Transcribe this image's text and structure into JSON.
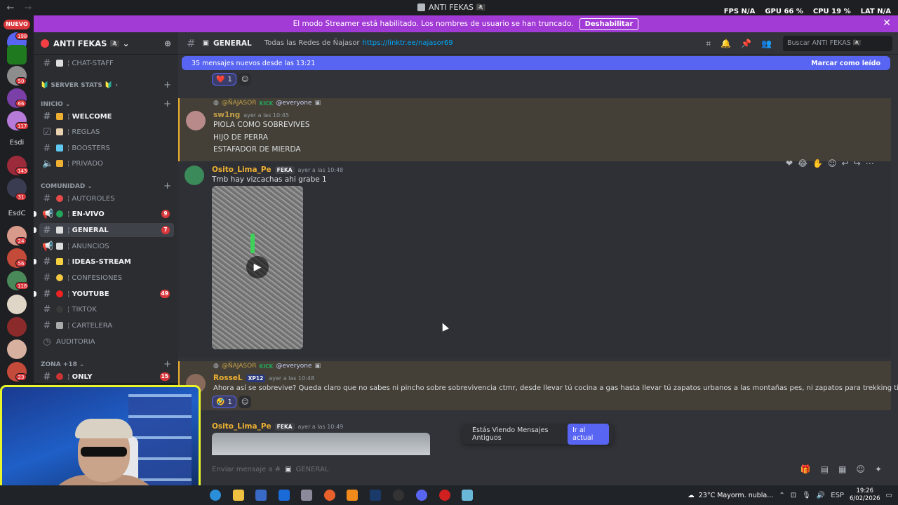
{
  "window": {
    "title": "ANTI FEKAS 🏴‍☠️"
  },
  "overlay": {
    "fps_label": "FPS",
    "fps": "N/A",
    "gpu_label": "GPU",
    "gpu": "66 %",
    "cpu_label": "CPU",
    "cpu": "19 %",
    "lat_label": "LAT",
    "lat": "N/A"
  },
  "banner": {
    "text": "El modo Streamer está habilitado. Los nombres de usuario se han truncado.",
    "button": "Deshabilitar",
    "close": "✕"
  },
  "rail": {
    "nuevo": "NUEVO",
    "badges": [
      "198",
      "50",
      "66",
      "117",
      "143",
      "31",
      "24",
      "56",
      "118",
      "23"
    ],
    "texts": [
      "Esdi",
      "EsdC"
    ]
  },
  "server": {
    "name": "ANTI FEKAS 🏴‍☠️"
  },
  "sidebar": {
    "channels": [
      {
        "label": "CHAT-STAFF"
      },
      {
        "label": "🔰 SERVER STATS 🔰"
      },
      {
        "label": "INICIO"
      },
      {
        "label": "WELCOME"
      },
      {
        "label": "REGLAS"
      },
      {
        "label": "BOOSTERS"
      },
      {
        "label": "PRIVADO"
      },
      {
        "label": "COMUNIDAD"
      },
      {
        "label": "AUTOROLES"
      },
      {
        "label": "EN-VIVO",
        "count": "9"
      },
      {
        "label": "GENERAL",
        "count": "7"
      },
      {
        "label": "ANUNCIOS"
      },
      {
        "label": "IDEAS-STREAM"
      },
      {
        "label": "CONFESIONES"
      },
      {
        "label": "YOUTUBE",
        "count": "49"
      },
      {
        "label": "TIKTOK"
      },
      {
        "label": "CARTELERA"
      },
      {
        "label": "AUDITORIA"
      },
      {
        "label": "ZONA +18"
      },
      {
        "label": "ONLY",
        "count": "15"
      }
    ]
  },
  "header": {
    "channel": "GENERAL",
    "topic": "Todas las Redes de Ñajasor",
    "link": "https://linktr.ee/najasor69",
    "search_placeholder": "Buscar ANTI FEKAS 🏴‍☠️"
  },
  "newbar": {
    "text": "35 mensajes nuevos desde las 13:21",
    "mark": "Marcar como leído"
  },
  "messages": [
    {
      "reply_user": "@ÑAJASOR",
      "reply_tag": "KICK",
      "reply_mention": "@everyone",
      "user": "sw1ng",
      "time": "ayer a las 10:45",
      "user_color": "#c5a04a",
      "lines": [
        "PIOLA COMO SOBREVIVES",
        "HIJO DE PERRA",
        "ESTAFADOR DE MIERDA"
      ]
    },
    {
      "user": "Osito_Lima_Pe",
      "tag": "FEKA",
      "time": "ayer a las 10:48",
      "user_color": "#f0b132",
      "lines": [
        "Tmb hay vizcachas ahi grabe 1"
      ]
    },
    {
      "reply_user": "@ÑAJASOR",
      "reply_tag": "KICK",
      "reply_mention": "@everyone",
      "user": "RosseL",
      "tag": "XP12",
      "time": "ayer a las 10:48",
      "user_color": "#f0b132",
      "lines": [
        "Ahora así se sobrevive? Queda claro que no sabes ni pincho sobre sobrevivencia ctmr, desde llevar tú cocina a gas hasta llevar tú zapatos urbanos a las montañas pes, ni zapatos para trekking tienes ctmr"
      ]
    },
    {
      "user": "Osito_Lima_Pe",
      "tag": "FEKA",
      "time": "ayer a las 10:49",
      "user_color": "#f0b132"
    }
  ],
  "reactions": [
    {
      "emoji": "❤️",
      "count": "1"
    },
    {
      "emoji": "🤣",
      "count": "1"
    }
  ],
  "old_messages": {
    "text": "Estás Viendo Mensajes Antiguos",
    "button": "Ir al actual"
  },
  "composer": {
    "placeholder": "Enviar mensaje a #",
    "channel": "GENERAL"
  },
  "taskbar": {
    "weather": "23°C  Mayorm. nubla...",
    "lang": "ESP",
    "time": "19:26",
    "date": "6/02/2026"
  }
}
